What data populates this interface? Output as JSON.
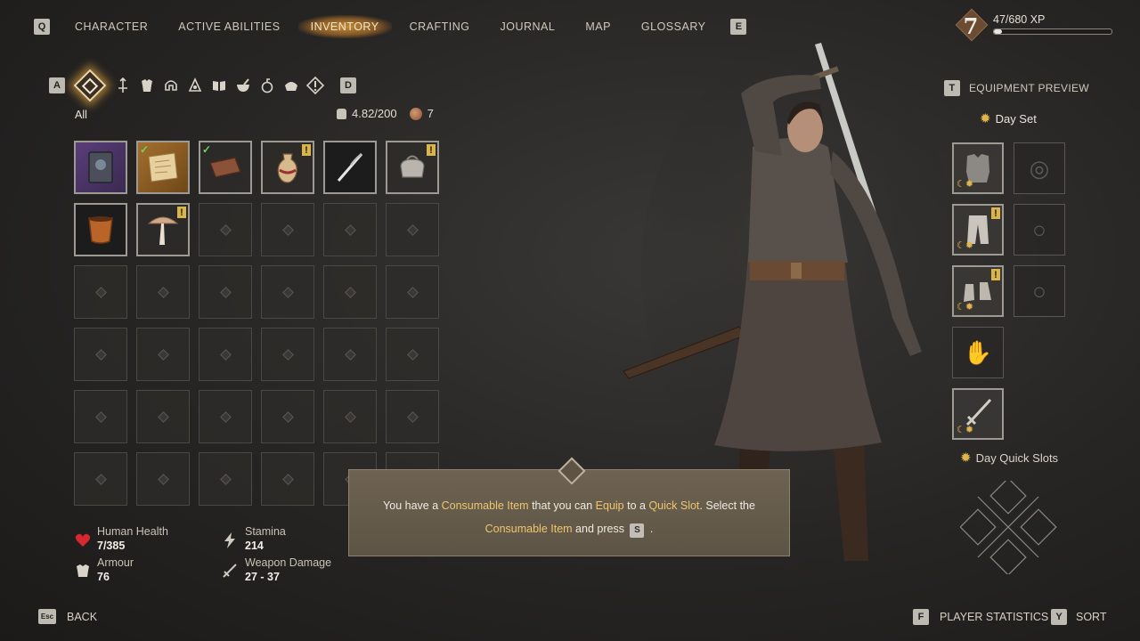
{
  "nav": {
    "key_left": "Q",
    "key_right": "E",
    "tabs": [
      "CHARACTER",
      "ACTIVE ABILITIES",
      "INVENTORY",
      "CRAFTING",
      "JOURNAL",
      "MAP",
      "GLOSSARY"
    ],
    "active_tab": "INVENTORY"
  },
  "player": {
    "level": "7",
    "xp_text": "47/680 XP",
    "xp_progress": 0.069
  },
  "categories": {
    "key_left": "A",
    "key_right": "D",
    "icons": [
      "all-items-icon",
      "weapons-icon",
      "armour-icon",
      "helmet-icon",
      "tools-icon",
      "books-icon",
      "mortar-icon",
      "bomb-icon",
      "food-icon",
      "alert-icon"
    ],
    "current_label": "All"
  },
  "inventory": {
    "weight": "4.82/200",
    "coins": "7",
    "items": [
      {
        "name": "book-item",
        "rarity": "purple",
        "check": false,
        "warn": false
      },
      {
        "name": "map-scroll-item",
        "rarity": "gold",
        "check": true,
        "warn": false
      },
      {
        "name": "leather-book-item",
        "rarity": "normal",
        "check": true,
        "warn": false
      },
      {
        "name": "potion-jug-item",
        "rarity": "normal",
        "check": false,
        "warn": true
      },
      {
        "name": "quill-item",
        "rarity": "dark",
        "check": false,
        "warn": false
      },
      {
        "name": "coin-purse-item",
        "rarity": "normal",
        "check": false,
        "warn": true
      },
      {
        "name": "cup-item",
        "rarity": "dark",
        "check": false,
        "warn": false
      },
      {
        "name": "mushroom-item",
        "rarity": "normal",
        "check": false,
        "warn": true
      }
    ],
    "total_slots": 36
  },
  "stats": {
    "health_label": "Human Health",
    "health_value": "7/385",
    "stamina_label": "Stamina",
    "stamina_value": "214",
    "armour_label": "Armour",
    "armour_value": "76",
    "damage_label": "Weapon Damage",
    "damage_value": "27 - 37"
  },
  "tooltip": {
    "p1": "You have a ",
    "h1": "Consumable Item",
    "p2": " that you can ",
    "h2": "Equip",
    "p3": " to a ",
    "h3": "Quick Slot",
    "p4": ". Select the",
    "h4": "Consumable Item",
    "p5": " and press ",
    "key": "S",
    "p6": " ."
  },
  "equipment": {
    "key": "T",
    "title": "EQUIPMENT PREVIEW",
    "set_label": "Day Set",
    "quick_label": "Day Quick Slots"
  },
  "footer": {
    "back_key": "Esc",
    "back_label": "BACK",
    "stats_key": "F",
    "stats_label": "PLAYER STATISTICS",
    "sort_key": "Y",
    "sort_label": "SORT"
  },
  "colors": {
    "accent": "#f1c56e",
    "active_tab_glow": "#d6963c",
    "tooltip_bg": "#665b4b"
  }
}
